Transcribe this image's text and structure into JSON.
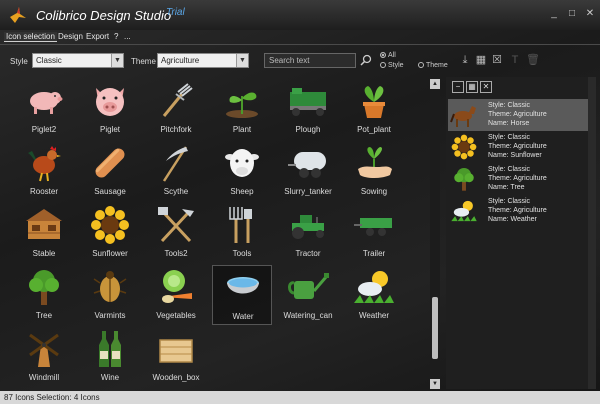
{
  "window": {
    "title": "Colibrico Design Studio",
    "badge": "Trial",
    "min": "_",
    "max": "□",
    "close": "✕"
  },
  "menu": [
    "Icon selection",
    "Design",
    "Export",
    "?",
    "..."
  ],
  "toolbar": {
    "style_label": "Style",
    "style_value": "Classic",
    "theme_label": "Theme",
    "theme_value": "Agriculture",
    "search_placeholder": "Search text",
    "radio_all": "All",
    "radio_style": "Style",
    "radio_theme": "Theme"
  },
  "icons": [
    {
      "label": "Piglet2",
      "icon": "piglet-icon"
    },
    {
      "label": "Piglet",
      "icon": "pig-face-icon"
    },
    {
      "label": "Pitchfork",
      "icon": "pitchfork-icon"
    },
    {
      "label": "Plant",
      "icon": "plant-icon"
    },
    {
      "label": "Plough",
      "icon": "plough-icon"
    },
    {
      "label": "Pot_plant",
      "icon": "pot-plant-icon"
    },
    {
      "label": "Rooster",
      "icon": "rooster-icon"
    },
    {
      "label": "Sausage",
      "icon": "sausage-icon"
    },
    {
      "label": "Scythe",
      "icon": "scythe-icon"
    },
    {
      "label": "Sheep",
      "icon": "sheep-icon"
    },
    {
      "label": "Slurry_tanker",
      "icon": "slurry-tanker-icon"
    },
    {
      "label": "Sowing",
      "icon": "sowing-icon"
    },
    {
      "label": "Stable",
      "icon": "stable-icon"
    },
    {
      "label": "Sunflower",
      "icon": "sunflower-icon"
    },
    {
      "label": "Tools2",
      "icon": "tools2-icon"
    },
    {
      "label": "Tools",
      "icon": "tools-icon"
    },
    {
      "label": "Tractor",
      "icon": "tractor-icon"
    },
    {
      "label": "Trailer",
      "icon": "trailer-icon"
    },
    {
      "label": "Tree",
      "icon": "tree-icon"
    },
    {
      "label": "Varmints",
      "icon": "beetle-icon"
    },
    {
      "label": "Vegetables",
      "icon": "vegetables-icon"
    },
    {
      "label": "Water",
      "icon": "water-bowl-icon"
    },
    {
      "label": "Watering_can",
      "icon": "watering-can-icon"
    },
    {
      "label": "Weather",
      "icon": "weather-icon"
    },
    {
      "label": "Windmill",
      "icon": "windmill-icon"
    },
    {
      "label": "Wine",
      "icon": "wine-icon"
    },
    {
      "label": "Wooden_box",
      "icon": "wooden-box-icon"
    }
  ],
  "selection": [
    {
      "style": "Style: Classic",
      "theme": "Theme: Agriculture",
      "name": "Name: Horse",
      "icon": "horse-icon"
    },
    {
      "style": "Style: Classic",
      "theme": "Theme: Agriculture",
      "name": "Name: Sunflower",
      "icon": "sunflower-icon"
    },
    {
      "style": "Style: Classic",
      "theme": "Theme: Agriculture",
      "name": "Name: Tree",
      "icon": "tree-icon"
    },
    {
      "style": "Style: Classic",
      "theme": "Theme: Agriculture",
      "name": "Name: Weather",
      "icon": "weather-icon"
    }
  ],
  "status": "87 Icons  Selection: 4 Icons"
}
